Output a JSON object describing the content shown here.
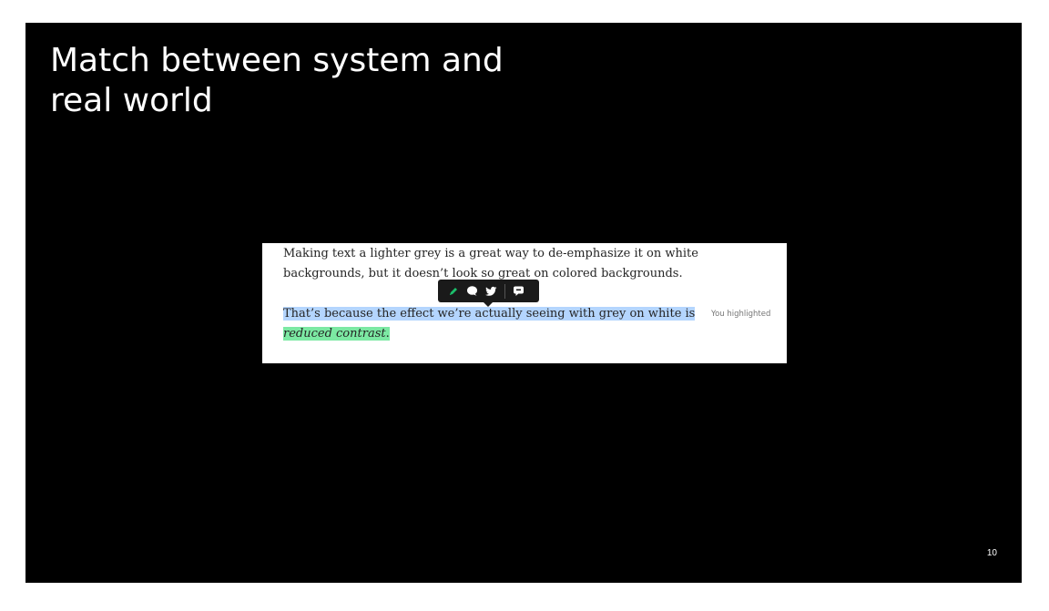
{
  "slide": {
    "title": "Match between system and real world",
    "page_number": "10"
  },
  "article": {
    "paragraph_1": "Making text a lighter grey is a great way to de-emphasize it on white backgrounds, but it doesn’t look so great on colored backgrounds.",
    "paragraph_2_selected": "That’s because the effect we’re actually seeing with grey on white is",
    "paragraph_2_space": " ",
    "paragraph_2_highlighted": "reduced contrast",
    "paragraph_2_period": ".",
    "side_note": "You highlighted"
  },
  "toolbar": {
    "buttons": [
      "highlight-icon",
      "respond-icon",
      "twitter-icon",
      "private-note-icon"
    ]
  },
  "colors": {
    "slide_background": "#000000",
    "selection_highlight": "#b4d5fe",
    "user_highlight": "#7ce9a3",
    "toolbar_background": "#1a1a1a",
    "highlight_icon": "#1cbf6b"
  }
}
